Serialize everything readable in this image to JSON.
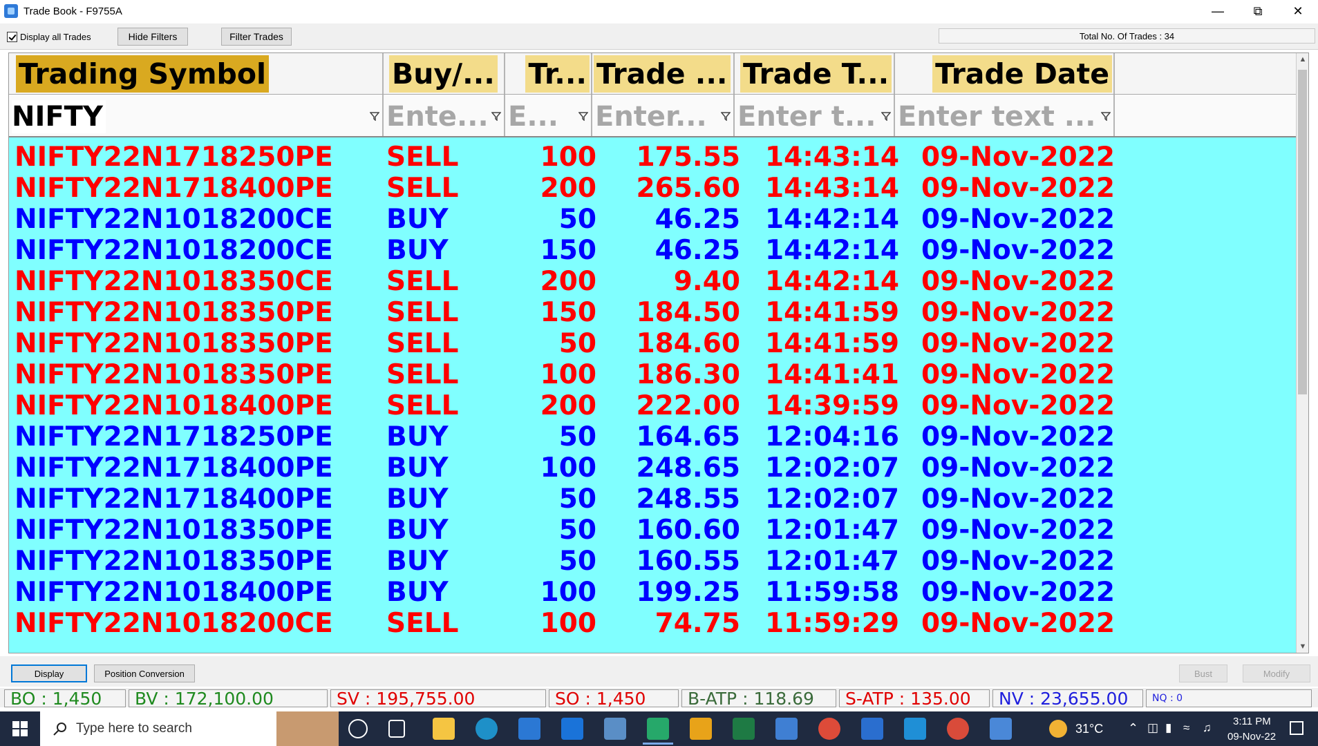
{
  "window": {
    "title": "Trade Book - F9755A"
  },
  "toolbar": {
    "display_all_label": "Display all Trades",
    "hide_filters": "Hide Filters",
    "filter_trades": "Filter Trades",
    "total_trades": "Total No. Of Trades : 34"
  },
  "columns": [
    {
      "header": "Trading Symbol",
      "filter": "NIFTY"
    },
    {
      "header": "Buy/...",
      "filter": "Ente..."
    },
    {
      "header": "Tr...",
      "filter": "E..."
    },
    {
      "header": "Trade ...",
      "filter": "Enter..."
    },
    {
      "header": "Trade T...",
      "filter": "Enter t..."
    },
    {
      "header": "Trade Date",
      "filter": "Enter text ..."
    }
  ],
  "trades": [
    {
      "symbol": "NIFTY22N1718250PE",
      "side": "SELL",
      "qty": "100",
      "price": "175.55",
      "time": "14:43:14",
      "date": "09-Nov-2022"
    },
    {
      "symbol": "NIFTY22N1718400PE",
      "side": "SELL",
      "qty": "200",
      "price": "265.60",
      "time": "14:43:14",
      "date": "09-Nov-2022"
    },
    {
      "symbol": "NIFTY22N1018200CE",
      "side": "BUY",
      "qty": "50",
      "price": "46.25",
      "time": "14:42:14",
      "date": "09-Nov-2022"
    },
    {
      "symbol": "NIFTY22N1018200CE",
      "side": "BUY",
      "qty": "150",
      "price": "46.25",
      "time": "14:42:14",
      "date": "09-Nov-2022"
    },
    {
      "symbol": "NIFTY22N1018350CE",
      "side": "SELL",
      "qty": "200",
      "price": "9.40",
      "time": "14:42:14",
      "date": "09-Nov-2022"
    },
    {
      "symbol": "NIFTY22N1018350PE",
      "side": "SELL",
      "qty": "150",
      "price": "184.50",
      "time": "14:41:59",
      "date": "09-Nov-2022"
    },
    {
      "symbol": "NIFTY22N1018350PE",
      "side": "SELL",
      "qty": "50",
      "price": "184.60",
      "time": "14:41:59",
      "date": "09-Nov-2022"
    },
    {
      "symbol": "NIFTY22N1018350PE",
      "side": "SELL",
      "qty": "100",
      "price": "186.30",
      "time": "14:41:41",
      "date": "09-Nov-2022"
    },
    {
      "symbol": "NIFTY22N1018400PE",
      "side": "SELL",
      "qty": "200",
      "price": "222.00",
      "time": "14:39:59",
      "date": "09-Nov-2022"
    },
    {
      "symbol": "NIFTY22N1718250PE",
      "side": "BUY",
      "qty": "50",
      "price": "164.65",
      "time": "12:04:16",
      "date": "09-Nov-2022"
    },
    {
      "symbol": "NIFTY22N1718400PE",
      "side": "BUY",
      "qty": "100",
      "price": "248.65",
      "time": "12:02:07",
      "date": "09-Nov-2022"
    },
    {
      "symbol": "NIFTY22N1718400PE",
      "side": "BUY",
      "qty": "50",
      "price": "248.55",
      "time": "12:02:07",
      "date": "09-Nov-2022"
    },
    {
      "symbol": "NIFTY22N1018350PE",
      "side": "BUY",
      "qty": "50",
      "price": "160.60",
      "time": "12:01:47",
      "date": "09-Nov-2022"
    },
    {
      "symbol": "NIFTY22N1018350PE",
      "side": "BUY",
      "qty": "50",
      "price": "160.55",
      "time": "12:01:47",
      "date": "09-Nov-2022"
    },
    {
      "symbol": "NIFTY22N1018400PE",
      "side": "BUY",
      "qty": "100",
      "price": "199.25",
      "time": "11:59:58",
      "date": "09-Nov-2022"
    },
    {
      "symbol": "NIFTY22N1018200CE",
      "side": "SELL",
      "qty": "100",
      "price": "74.75",
      "time": "11:59:29",
      "date": "09-Nov-2022"
    }
  ],
  "bottom_buttons": {
    "display": "Display",
    "position_conversion": "Position Conversion",
    "bust": "Bust",
    "modify": "Modify"
  },
  "summary": {
    "bo": "BO : 1,450",
    "bv": "BV : 172,100.00",
    "sv": "SV : 195,755.00",
    "so": "SO : 1,450",
    "batp": "B-ATP : 118.69",
    "satp": "S-ATP : 135.00",
    "nv": "NV : 23,655.00",
    "nq": "NQ : 0"
  },
  "taskbar": {
    "search_placeholder": "Type here to search",
    "weather": "31°C",
    "time": "3:11 PM",
    "date": "09-Nov-22"
  },
  "colors": {
    "sell": "#ff0000",
    "buy": "#0000ff",
    "grid_bg": "#80ffff"
  }
}
